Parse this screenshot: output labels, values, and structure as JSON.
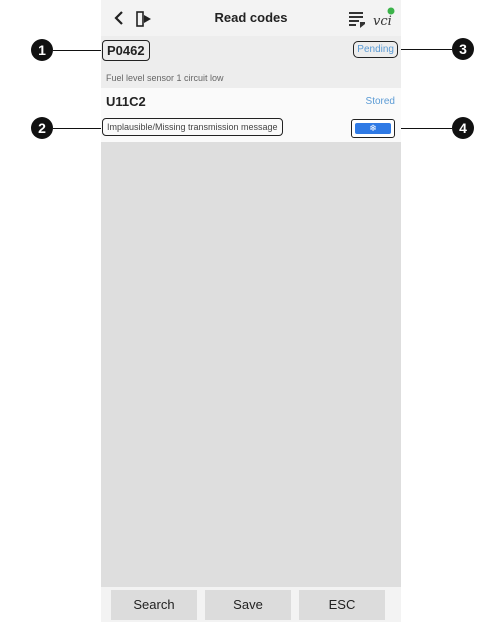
{
  "header": {
    "title": "Read codes",
    "icons": [
      "back-icon",
      "exit-icon",
      "report-icon",
      "vci-icon"
    ]
  },
  "dtcs": [
    {
      "code": "P0462",
      "status": "Pending",
      "description": "Fuel level sensor 1 circuit low"
    },
    {
      "code": "U11C2",
      "status": "Stored",
      "description": "Implausible/Missing transmission message",
      "freeze_frame_icon": "snowflake-icon"
    }
  ],
  "callouts": [
    "1",
    "2",
    "3",
    "4"
  ],
  "bottom_bar": {
    "search_label": "Search",
    "save_label": "Save",
    "esc_label": "ESC"
  },
  "colors": {
    "status_blue": "#5b9bd5",
    "freeze_button_blue": "#2f7ae5"
  }
}
